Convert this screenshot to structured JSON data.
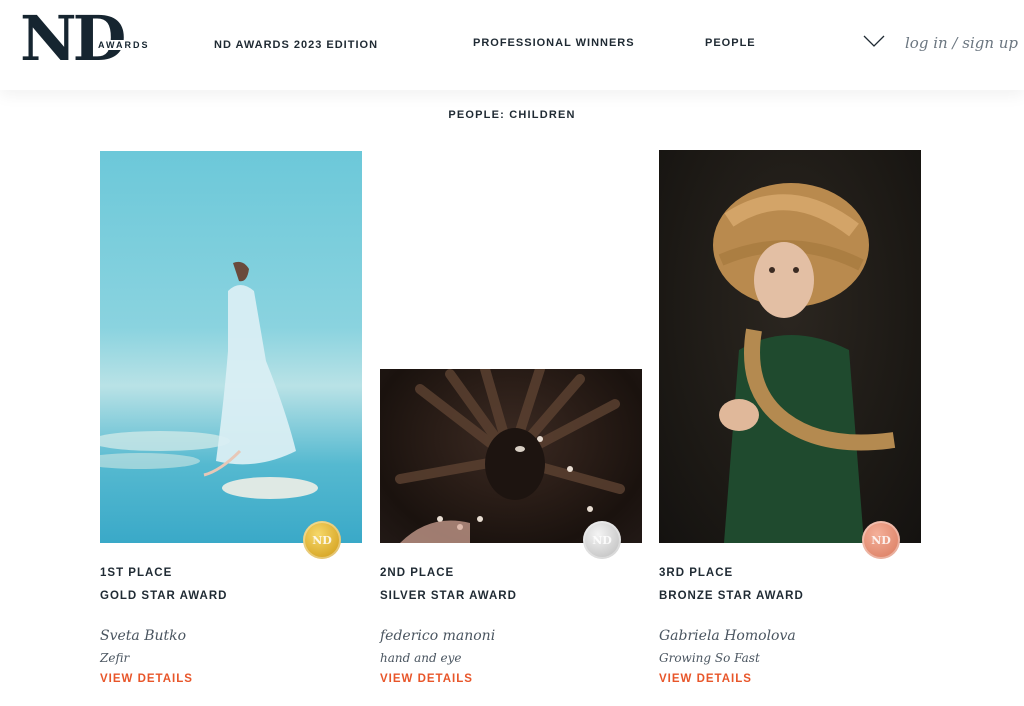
{
  "header": {
    "logo_text": "ND",
    "logo_sub": "AWARDS",
    "nav": {
      "edition": "ND AWARDS 2023 EDITION",
      "professional": "PROFESSIONAL WINNERS",
      "people": "PEOPLE"
    },
    "login": "log in / sign up"
  },
  "section_title": "PEOPLE: CHILDREN",
  "cards": [
    {
      "place": "1ST PLACE",
      "award": "GOLD STAR AWARD",
      "artist": "Sveta Butko",
      "work": "Zefir",
      "details": "VIEW DETAILS",
      "medal_color": "#d9a92a"
    },
    {
      "place": "2ND PLACE",
      "award": "SILVER STAR AWARD",
      "artist": "federico manoni",
      "work": "hand and eye",
      "details": "VIEW DETAILS",
      "medal_color": "#c9c9c9"
    },
    {
      "place": "3RD PLACE",
      "award": "BRONZE STAR AWARD",
      "artist": "Gabriela Homolova",
      "work": "Growing So Fast",
      "details": "VIEW DETAILS",
      "medal_color": "#e0876c"
    }
  ],
  "colors": {
    "accent": "#e8562a",
    "text": "#1f2a33"
  }
}
